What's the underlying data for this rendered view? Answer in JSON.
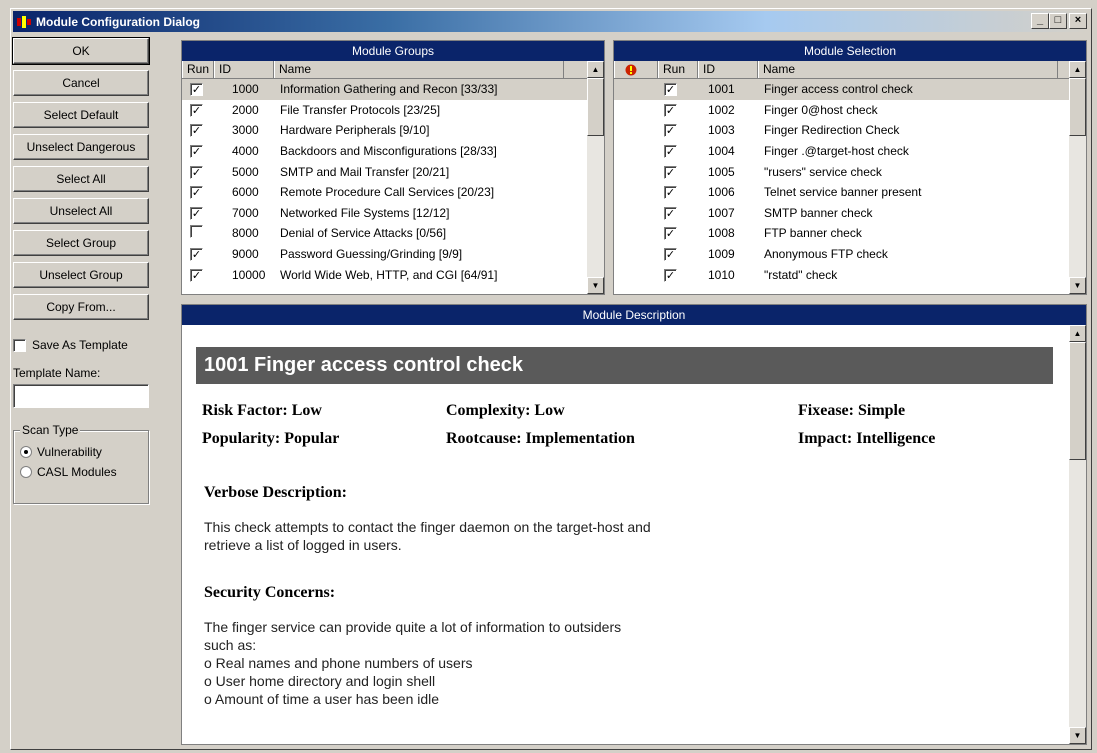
{
  "window": {
    "title": "Module Configuration Dialog",
    "minimize": "_",
    "maximize": "□",
    "close": "×"
  },
  "left": {
    "buttons": [
      "OK",
      "Cancel",
      "Select Default",
      "Unselect Dangerous",
      "Select All",
      "Unselect All",
      "Select Group",
      "Unselect Group",
      "Copy From..."
    ],
    "save_as_template": "Save As Template",
    "save_as_template_checked": false,
    "template_name_label": "Template Name:",
    "template_name_value": "",
    "scan_type": {
      "title": "Scan Type",
      "options": [
        {
          "label": "Vulnerability",
          "selected": true
        },
        {
          "label": "CASL Modules",
          "selected": false
        }
      ]
    }
  },
  "groups": {
    "title": "Module Groups",
    "columns": [
      "Run",
      "ID",
      "Name"
    ],
    "rows": [
      {
        "run": true,
        "id": "1000",
        "name": "Information Gathering and Recon [33/33]",
        "selected": true
      },
      {
        "run": true,
        "id": "2000",
        "name": "File Transfer Protocols [23/25]"
      },
      {
        "run": true,
        "id": "3000",
        "name": "Hardware Peripherals [9/10]"
      },
      {
        "run": true,
        "id": "4000",
        "name": "Backdoors and Misconfigurations [28/33]"
      },
      {
        "run": true,
        "id": "5000",
        "name": "SMTP and Mail Transfer [20/21]"
      },
      {
        "run": true,
        "id": "6000",
        "name": "Remote Procedure Call Services [20/23]"
      },
      {
        "run": true,
        "id": "7000",
        "name": "Networked File Systems [12/12]"
      },
      {
        "run": false,
        "id": "8000",
        "name": "Denial of Service Attacks [0/56]"
      },
      {
        "run": true,
        "id": "9000",
        "name": "Password Guessing/Grinding [9/9]"
      },
      {
        "run": true,
        "id": "10000",
        "name": "World Wide Web, HTTP, and CGI [64/91]"
      }
    ]
  },
  "selection": {
    "title": "Module Selection",
    "columns": [
      "!",
      "Run",
      "ID",
      "Name"
    ],
    "rows": [
      {
        "run": true,
        "id": "1001",
        "name": "Finger access control check",
        "selected": true
      },
      {
        "run": true,
        "id": "1002",
        "name": "Finger 0@host check"
      },
      {
        "run": true,
        "id": "1003",
        "name": "Finger Redirection Check"
      },
      {
        "run": true,
        "id": "1004",
        "name": "Finger .@target-host check"
      },
      {
        "run": true,
        "id": "1005",
        "name": "\"rusers\" service check"
      },
      {
        "run": true,
        "id": "1006",
        "name": "Telnet service banner present"
      },
      {
        "run": true,
        "id": "1007",
        "name": "SMTP banner check"
      },
      {
        "run": true,
        "id": "1008",
        "name": "FTP banner check"
      },
      {
        "run": true,
        "id": "1009",
        "name": "Anonymous FTP check"
      },
      {
        "run": true,
        "id": "1010",
        "name": "\"rstatd\" check"
      }
    ]
  },
  "description": {
    "title": "Module Description",
    "heading": "1001  Finger access control check",
    "facts": {
      "risk": "Risk Factor: Low",
      "complexity": "Complexity: Low",
      "fixease": "Fixease: Simple",
      "popularity": "Popularity: Popular",
      "rootcause": "Rootcause: Implementation",
      "impact": "Impact: Intelligence"
    },
    "verbose_heading": "Verbose Description:",
    "verbose_text": "This check attempts to contact the finger daemon on the target-host and\nretrieve a list of logged in users.",
    "security_heading": "Security Concerns:",
    "security_text": "The finger service can provide quite a lot of information to outsiders\nsuch as:\n  o Real names and phone numbers of users\n  o User home directory and login shell\n  o Amount of time a user has been idle"
  },
  "colors": {
    "panel_header": "#0a246a",
    "heading_bar": "#5a5a5a",
    "warning_icon": "#cc2200"
  }
}
